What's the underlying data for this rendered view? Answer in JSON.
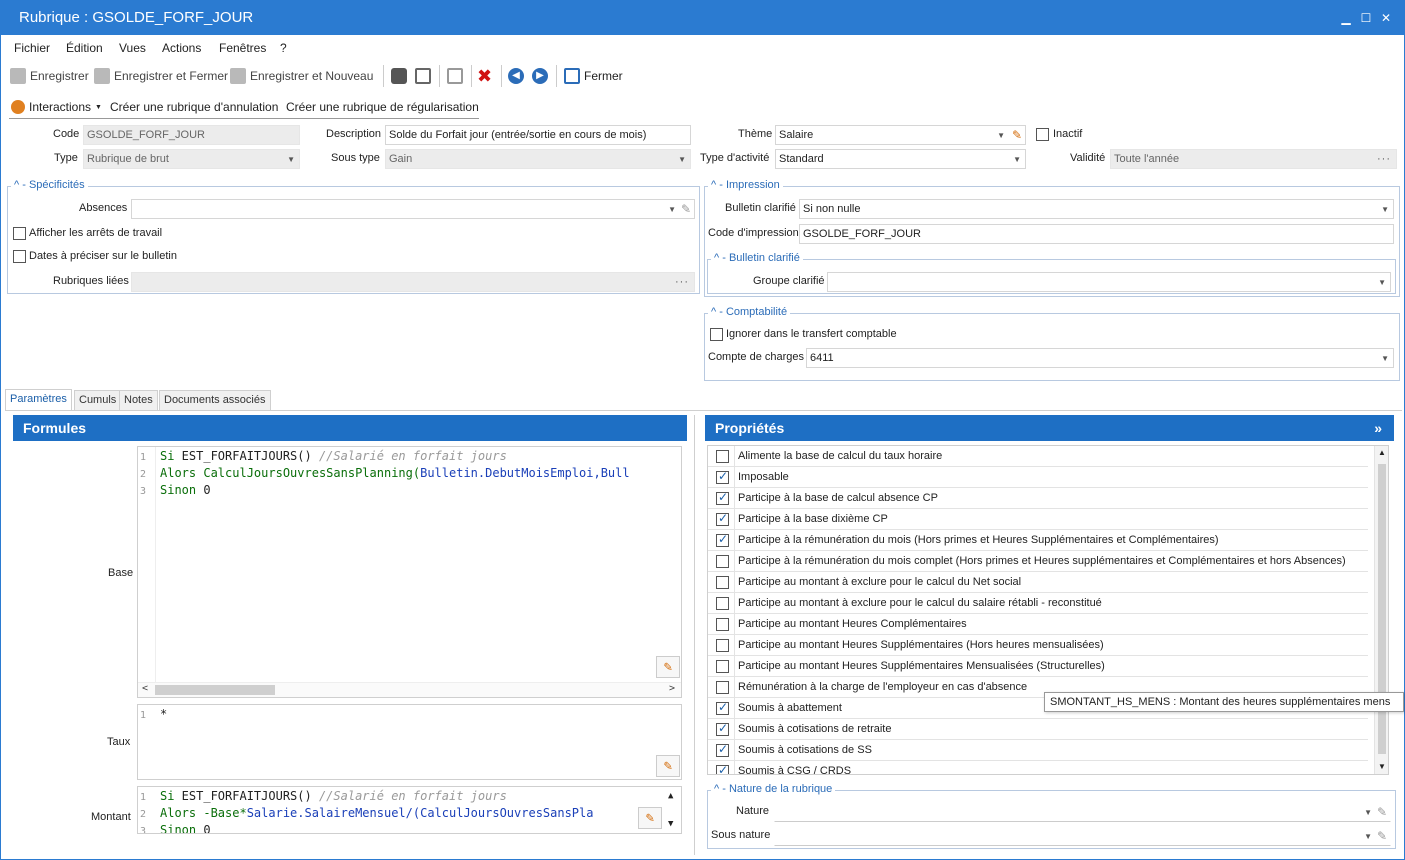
{
  "window": {
    "title": "Rubrique : GSOLDE_FORF_JOUR"
  },
  "menu": [
    "Fichier",
    "Édition",
    "Vues",
    "Actions",
    "Fenêtres",
    "?"
  ],
  "toolbar": {
    "save": "Enregistrer",
    "save_close": "Enregistrer et Fermer",
    "save_new": "Enregistrer et Nouveau",
    "close": "Fermer"
  },
  "actions": {
    "interactions": "Interactions",
    "create_cancel": "Créer une rubrique d'annulation",
    "create_regul": "Créer une rubrique de régularisation"
  },
  "form": {
    "code_label": "Code",
    "code": "GSOLDE_FORF_JOUR",
    "type_label": "Type",
    "type": "Rubrique de brut",
    "desc_label": "Description",
    "desc": "Solde du Forfait jour (entrée/sortie en cours de mois)",
    "soustype_label": "Sous type",
    "soustype": "Gain",
    "theme_label": "Thème",
    "theme": "Salaire",
    "typeact_label": "Type d'activité",
    "typeact": "Standard",
    "inactif_label": "Inactif",
    "validite_label": "Validité",
    "validite": "Toute l'année"
  },
  "specificites": {
    "title": "Spécificités",
    "absences_label": "Absences",
    "absences": "",
    "arrets_label": "Afficher les arrêts de travail",
    "dates_label": "Dates à préciser sur le bulletin",
    "liees_label": "Rubriques liées",
    "liees": ""
  },
  "impression": {
    "title": "Impression",
    "bulletin_label": "Bulletin clarifié",
    "bulletin": "Si non nulle",
    "code_label": "Code d'impression",
    "code": "GSOLDE_FORF_JOUR",
    "sub_title": "Bulletin clarifié",
    "groupe_label": "Groupe clarifié",
    "groupe": ""
  },
  "comptabilite": {
    "title": "Comptabilité",
    "ignorer_label": "Ignorer dans le transfert comptable",
    "compte_label": "Compte de charges",
    "compte": "6411"
  },
  "tabs": [
    "Paramètres",
    "Cumuls",
    "Notes",
    "Documents associés"
  ],
  "formules": {
    "title": "Formules",
    "base_label": "Base",
    "taux_label": "Taux",
    "montant_label": "Montant",
    "base_lines": [
      {
        "n": "1",
        "kw": "Si",
        "rest": " EST_FORFAITJOURS()",
        "comment": " //Salarié en forfait jours"
      },
      {
        "n": "2",
        "kw": "Alors",
        "rest": " CalculJoursOuvresSansPlanning(",
        "obj": "Bulletin.DebutMoisEmploi,Bull"
      },
      {
        "n": "3",
        "kw": "Sinon",
        "rest": " 0"
      }
    ],
    "taux_line": {
      "n": "1",
      "text": "*"
    },
    "montant_lines": [
      {
        "n": "1",
        "kw": "Si",
        "rest": " EST_FORFAITJOURS()",
        "comment": " //Salarié en forfait jours"
      },
      {
        "n": "2",
        "kw": "Alors",
        "rest": " -Base*",
        "obj": "Salarie.SalaireMensuel/(CalculJoursOuvresSansPla"
      },
      {
        "n": "3",
        "kw": "Sinon",
        "rest": " 0"
      }
    ]
  },
  "proprietes": {
    "title": "Propriétés",
    "items": [
      {
        "label": "Alimente la base de calcul du taux horaire",
        "checked": false
      },
      {
        "label": "Imposable",
        "checked": true
      },
      {
        "label": "Participe à la base de calcul absence CP",
        "checked": true
      },
      {
        "label": "Participe à la base dixième CP",
        "checked": true
      },
      {
        "label": "Participe à la rémunération du mois (Hors primes et Heures Supplémentaires et Complémentaires)",
        "checked": true
      },
      {
        "label": "Participe à la rémunération du mois complet (Hors primes et Heures supplémentaires et Complémentaires et hors Absences)",
        "checked": false
      },
      {
        "label": "Participe au montant à exclure pour le calcul du Net social",
        "checked": false
      },
      {
        "label": "Participe au montant à exclure pour le calcul du salaire rétabli - reconstitué",
        "checked": false
      },
      {
        "label": "Participe au montant Heures Complémentaires",
        "checked": false
      },
      {
        "label": "Participe au montant Heures Supplémentaires (Hors heures mensualisées)",
        "checked": false
      },
      {
        "label": "Participe au montant Heures Supplémentaires Mensualisées (Structurelles)",
        "checked": false
      },
      {
        "label": "Rémunération à la charge de l'employeur en cas d'absence",
        "checked": false
      },
      {
        "label": "Soumis à abattement",
        "checked": true
      },
      {
        "label": "Soumis à cotisations de retraite",
        "checked": true
      },
      {
        "label": "Soumis à cotisations de SS",
        "checked": true
      },
      {
        "label": "Soumis à CSG / CRDS",
        "checked": true
      }
    ],
    "tooltip": "SMONTANT_HS_MENS : Montant des heures supplémentaires mens"
  },
  "nature": {
    "title": "Nature de la rubrique",
    "nature_label": "Nature",
    "nature": "",
    "sousnature_label": "Sous nature",
    "sousnature": ""
  }
}
